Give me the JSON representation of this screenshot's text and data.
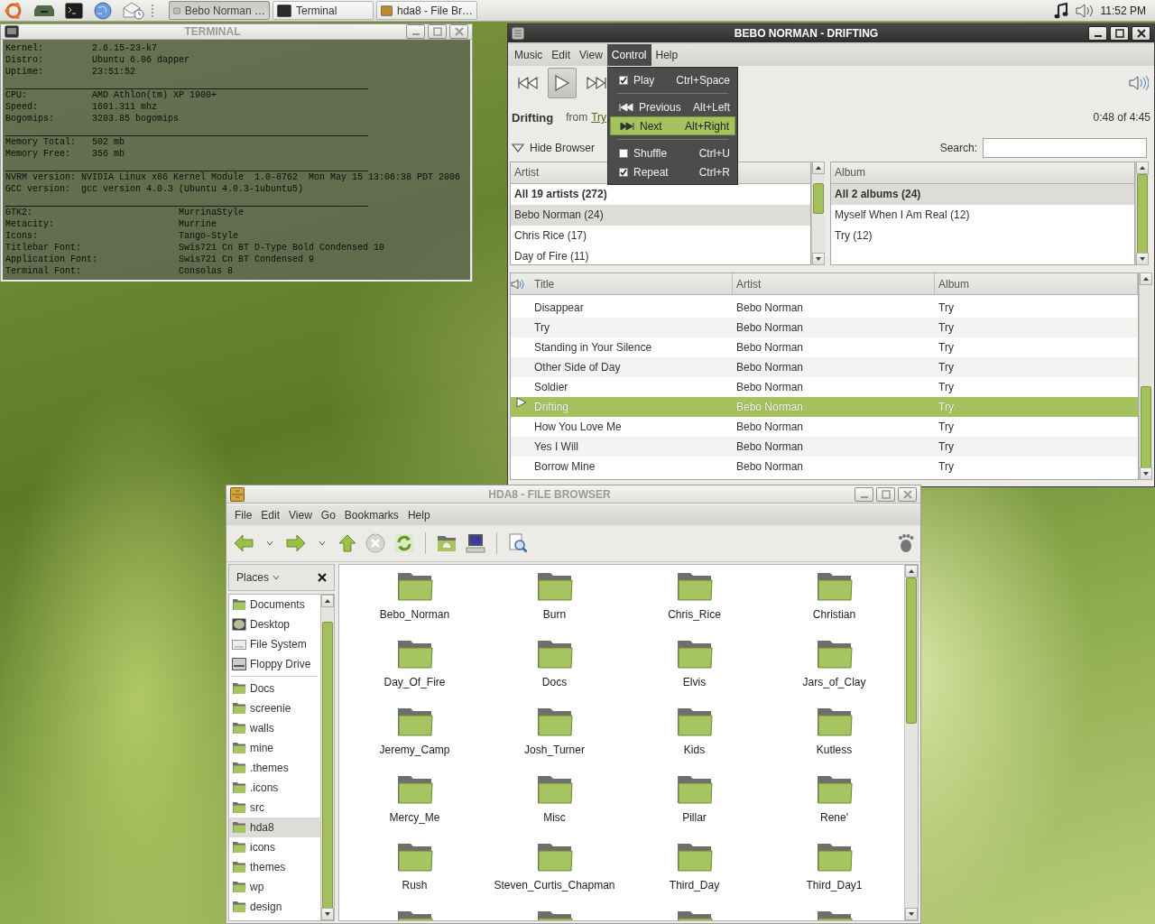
{
  "top_panel": {
    "tasks": [
      {
        "label": "Bebo Norman …",
        "selected": true
      },
      {
        "label": "Terminal",
        "selected": false
      },
      {
        "label": "hda8 - File Br…",
        "selected": false
      }
    ],
    "clock": "11:52 PM"
  },
  "terminal": {
    "title": "TERMINAL",
    "lines": [
      {
        "kind": "text",
        "text": "Kernel:         2.6.15-23-k7"
      },
      {
        "kind": "text",
        "text": "Distro:         Ubuntu 6.06 dapper"
      },
      {
        "kind": "text",
        "text": "Uptime:         23:51:52"
      },
      {
        "kind": "rule"
      },
      {
        "kind": "text",
        "text": "CPU:            AMD Athlon(tm) XP 1900+"
      },
      {
        "kind": "text",
        "text": "Speed:          1601.311 mhz"
      },
      {
        "kind": "text",
        "text": "Bogomips:       3203.85 bogomips"
      },
      {
        "kind": "rule"
      },
      {
        "kind": "text",
        "text": "Memory Total:   502 mb"
      },
      {
        "kind": "text",
        "text": "Memory Free:    356 mb"
      },
      {
        "kind": "rule"
      },
      {
        "kind": "text",
        "text": "NVRM version: NVIDIA Linux x86 Kernel Module  1.0-8762  Mon May 15 13:06:38 PDT 2006"
      },
      {
        "kind": "text",
        "text": "GCC version:  gcc version 4.0.3 (Ubuntu 4.0.3-1ubuntu5)"
      },
      {
        "kind": "rule"
      },
      {
        "kind": "text",
        "text": "GTK2:                           MurrinaStyle"
      },
      {
        "kind": "text",
        "text": "Metacity:                       Murrine"
      },
      {
        "kind": "text",
        "text": "Icons:                          Tango-Style"
      },
      {
        "kind": "text",
        "text": "Titlebar Font:                  Swis721 Cn BT D-Type Bold Condensed 10"
      },
      {
        "kind": "text",
        "text": "Application Font:               Swis721 Cn BT Condensed 9"
      },
      {
        "kind": "text",
        "text": "Terminal Font:                  Consolas 8"
      }
    ]
  },
  "music": {
    "title": "BEBO NORMAN - DRIFTING",
    "menu": [
      {
        "label": "Music",
        "selected": false
      },
      {
        "label": "Edit",
        "selected": false
      },
      {
        "label": "View",
        "selected": false
      },
      {
        "label": "Control",
        "selected": true
      },
      {
        "label": "Help",
        "selected": false
      }
    ],
    "control_menu": [
      {
        "kind": "check",
        "label": "Play",
        "shortcut": "Ctrl+Space",
        "checked": true,
        "selected": false
      },
      {
        "kind": "separator"
      },
      {
        "kind": "previous",
        "label": "Previous",
        "shortcut": "Alt+Left",
        "selected": false
      },
      {
        "kind": "next",
        "label": "Next",
        "shortcut": "Alt+Right",
        "selected": true
      },
      {
        "kind": "separator"
      },
      {
        "kind": "check",
        "label": "Shuffle",
        "shortcut": "Ctrl+U",
        "checked": false,
        "selected": false
      },
      {
        "kind": "check",
        "label": "Repeat",
        "shortcut": "Ctrl+R",
        "checked": true,
        "selected": false
      }
    ],
    "now_playing": {
      "title": "Drifting",
      "from": "from",
      "album": "Try",
      "time": "0:48 of 4:45"
    },
    "browser_toggle": {
      "label": "Hide Browser"
    },
    "search": {
      "label": "Search:"
    },
    "artists": {
      "header": "Artist",
      "items": [
        {
          "label": "All 19 artists (272)",
          "selected": false
        },
        {
          "label": "Bebo Norman (24)",
          "selected": true
        },
        {
          "label": "Chris Rice (17)",
          "selected": false
        },
        {
          "label": "Day of Fire (11)",
          "selected": false
        }
      ]
    },
    "albums": {
      "header": "Album",
      "items": [
        {
          "label": "All 2 albums (24)",
          "selected": true
        },
        {
          "label": "Myself When I Am Real (12)",
          "selected": false
        },
        {
          "label": "Try (12)",
          "selected": false
        }
      ]
    },
    "tracks": {
      "columns": [
        "Title",
        "Artist",
        "Album"
      ],
      "rows": [
        {
          "title": "Disappear",
          "artist": "Bebo Norman",
          "album": "Try",
          "selected": false,
          "playing": false
        },
        {
          "title": "Try",
          "artist": "Bebo Norman",
          "album": "Try",
          "selected": false,
          "playing": false
        },
        {
          "title": "Standing in Your Silence",
          "artist": "Bebo Norman",
          "album": "Try",
          "selected": false,
          "playing": false
        },
        {
          "title": "Other Side of Day",
          "artist": "Bebo Norman",
          "album": "Try",
          "selected": false,
          "playing": false
        },
        {
          "title": "Soldier",
          "artist": "Bebo Norman",
          "album": "Try",
          "selected": false,
          "playing": false
        },
        {
          "title": "Drifting",
          "artist": "Bebo Norman",
          "album": "Try",
          "selected": true,
          "playing": true
        },
        {
          "title": "How You Love Me",
          "artist": "Bebo Norman",
          "album": "Try",
          "selected": false,
          "playing": false
        },
        {
          "title": "Yes I Will",
          "artist": "Bebo Norman",
          "album": "Try",
          "selected": false,
          "playing": false
        },
        {
          "title": "Borrow Mine",
          "artist": "Bebo Norman",
          "album": "Try",
          "selected": false,
          "playing": false
        }
      ]
    }
  },
  "files": {
    "title": "HDA8 - FILE BROWSER",
    "menu": [
      "File",
      "Edit",
      "View",
      "Go",
      "Bookmarks",
      "Help"
    ],
    "places": {
      "label": "Places",
      "sections": [
        {
          "items": [
            {
              "label": "Documents",
              "selected": false
            },
            {
              "label": "Desktop",
              "selected": false
            },
            {
              "label": "File System",
              "selected": false
            },
            {
              "label": "Floppy Drive",
              "selected": false
            }
          ]
        },
        {
          "items": [
            {
              "label": "Docs",
              "selected": false
            },
            {
              "label": "screenie",
              "selected": false
            },
            {
              "label": "walls",
              "selected": false
            },
            {
              "label": "mine",
              "selected": false
            },
            {
              "label": ".themes",
              "selected": false
            },
            {
              "label": ".icons",
              "selected": false
            },
            {
              "label": "src",
              "selected": false
            },
            {
              "label": "hda8",
              "selected": true
            },
            {
              "label": "icons",
              "selected": false
            },
            {
              "label": "themes",
              "selected": false
            },
            {
              "label": "wp",
              "selected": false
            },
            {
              "label": "design",
              "selected": false
            }
          ]
        }
      ]
    },
    "folders": [
      "Bebo_Norman",
      "Burn",
      "Chris_Rice",
      "Christian",
      "Day_Of_Fire",
      "Docs",
      "Elvis",
      "Jars_of_Clay",
      "Jeremy_Camp",
      "Josh_Turner",
      "Kids",
      "Kutless",
      "Mercy_Me",
      "Misc",
      "Pillar",
      "Rene'",
      "Rush",
      "Steven_Curtis_Chapman",
      "Third_Day",
      "Third_Day1"
    ]
  }
}
